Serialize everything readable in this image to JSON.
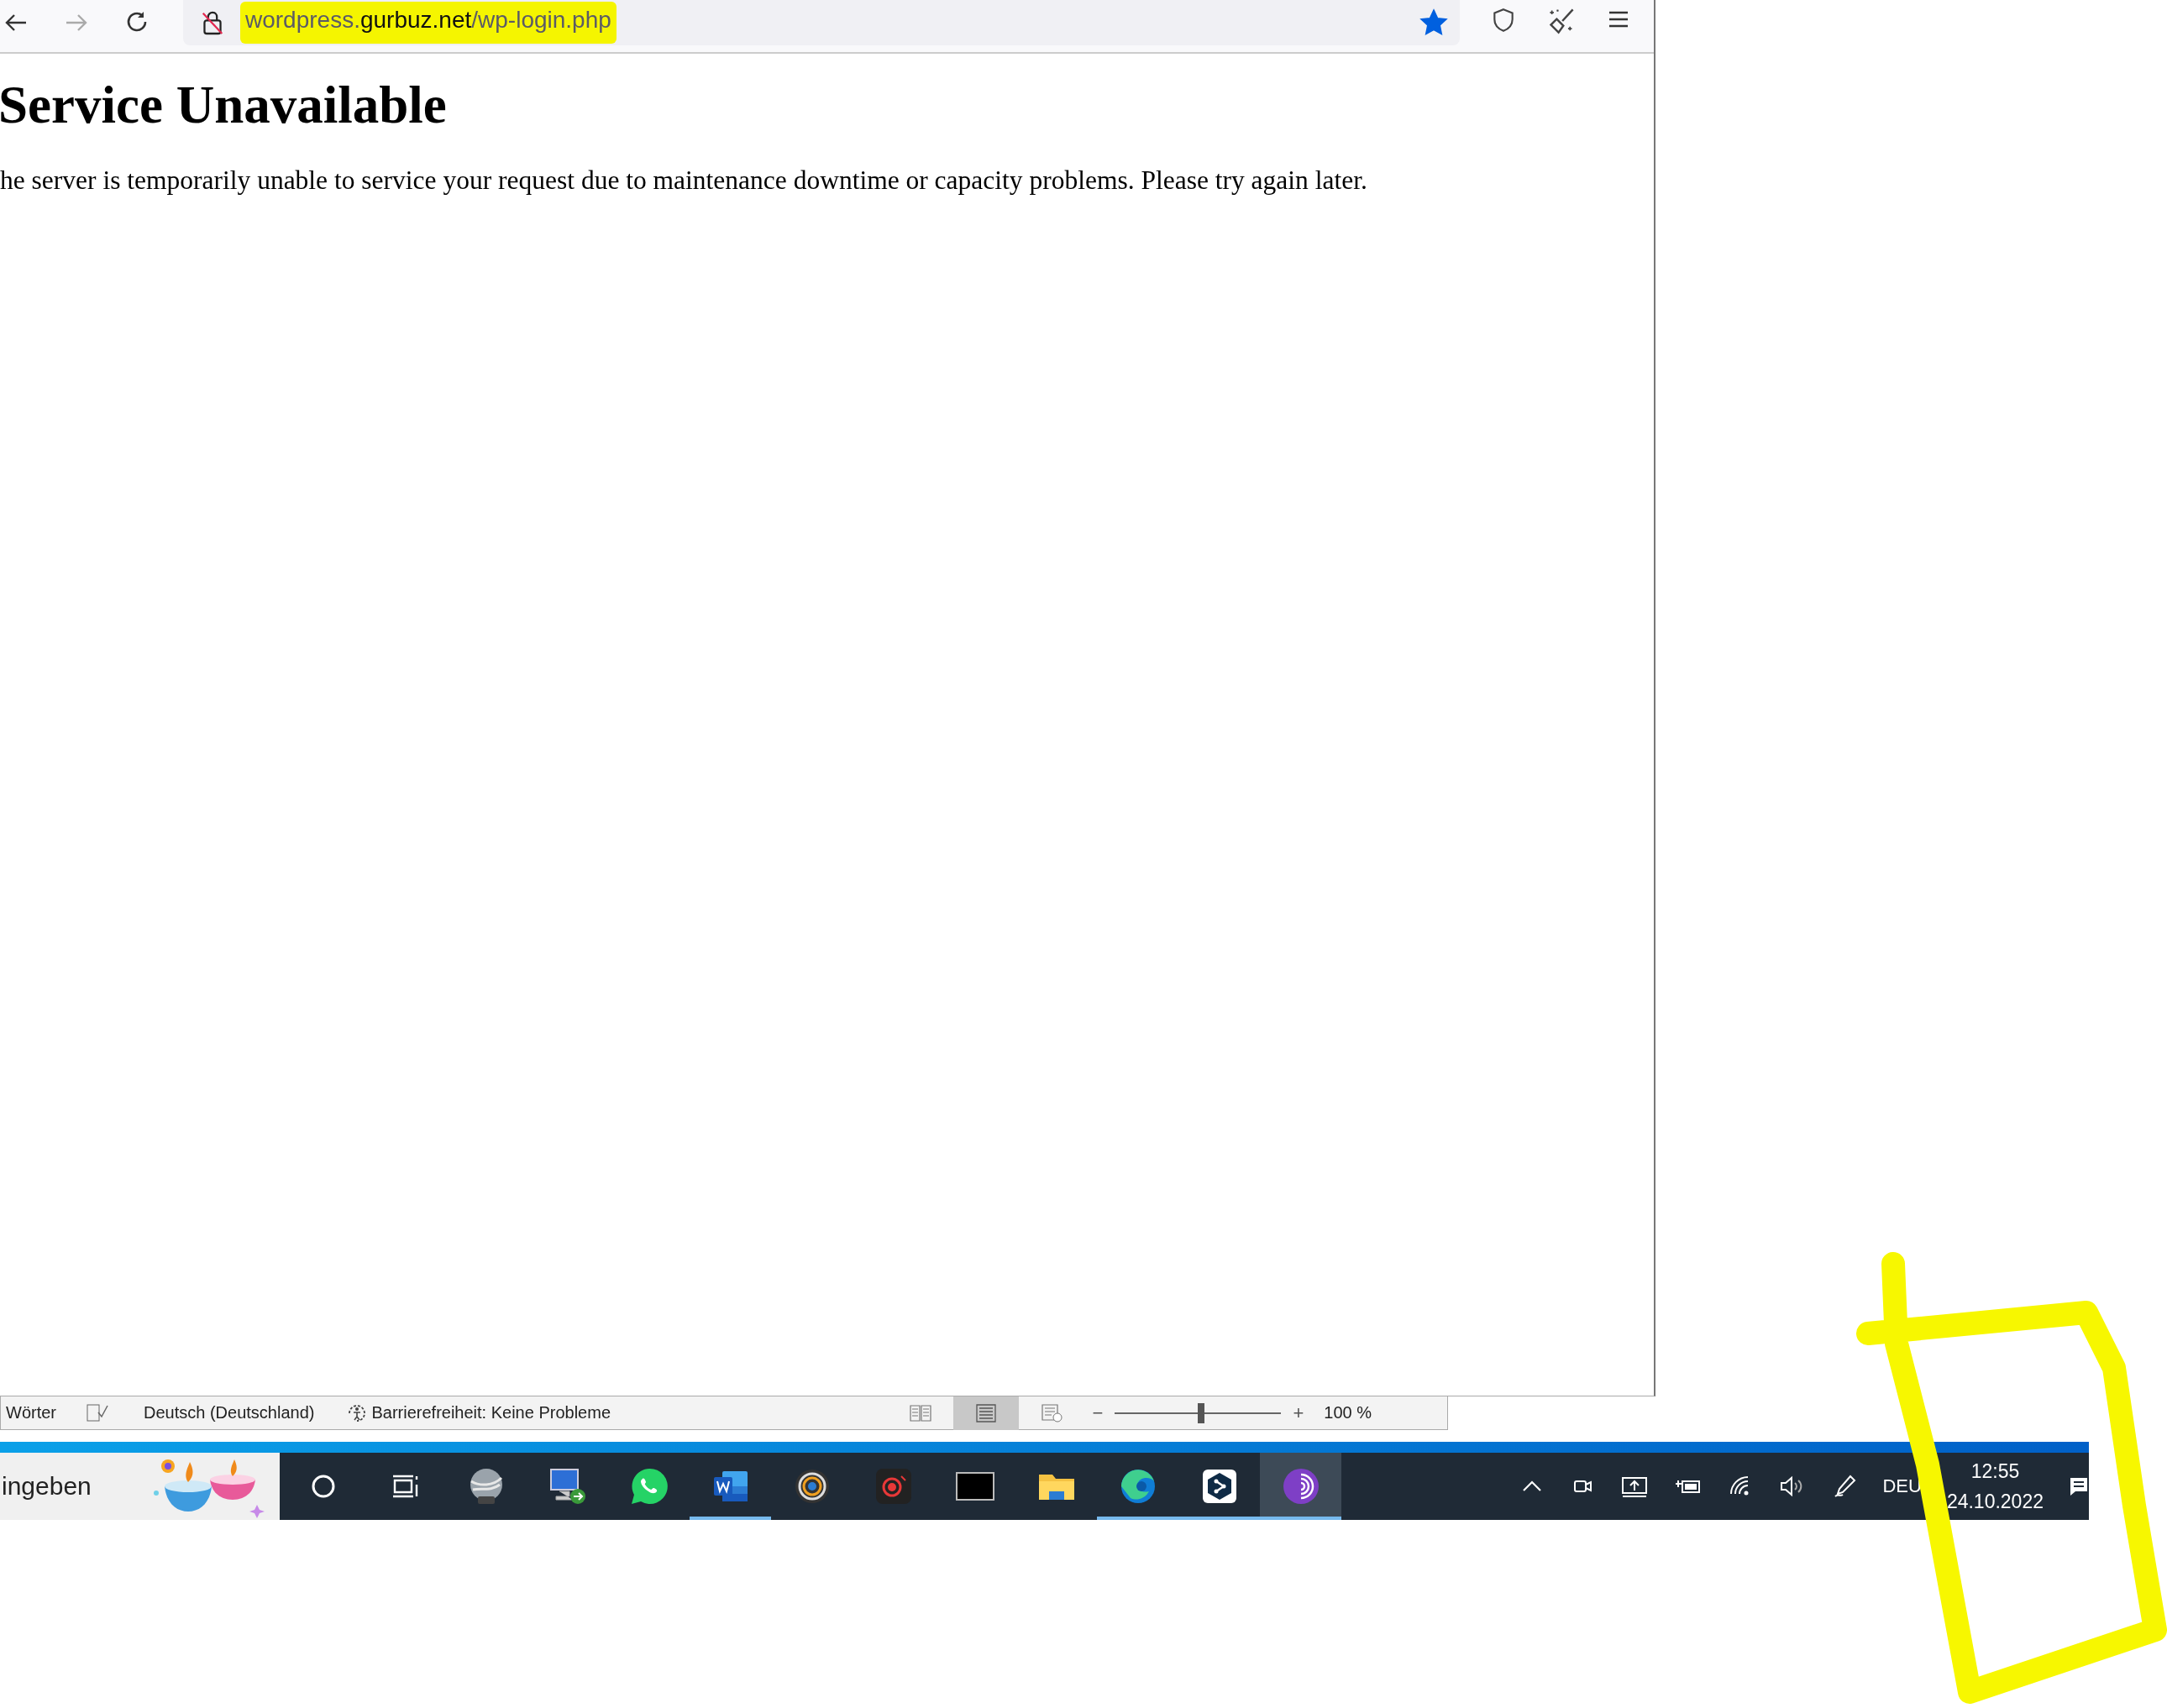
{
  "browser": {
    "url": {
      "prefix": "wordpress.",
      "domain": "gurbuz.net",
      "path": "/wp-login.php"
    },
    "bookmarked": true
  },
  "page": {
    "heading": "Service Unavailable",
    "message": "he server is temporarily unable to service your request due to maintenance downtime or capacity problems. Please try again later."
  },
  "word_status_bar": {
    "words": "Wörter",
    "language": "Deutsch (Deutschland)",
    "accessibility": "Barrierefreiheit: Keine Probleme",
    "views": [
      {
        "kind": "read",
        "selected": false
      },
      {
        "kind": "print",
        "selected": true
      },
      {
        "kind": "web",
        "selected": false
      }
    ],
    "zoom": {
      "out_sign": "−",
      "level": 0.5,
      "in_sign": "+",
      "reading": "100 %"
    }
  },
  "taskbar": {
    "search_text": "ingeben",
    "apps": [
      {
        "kind": "cortana",
        "running": false,
        "selected": false
      },
      {
        "kind": "taskview",
        "running": false,
        "selected": false
      },
      {
        "kind": "globe",
        "running": false,
        "selected": false
      },
      {
        "kind": "remote",
        "running": false,
        "selected": false
      },
      {
        "kind": "chat",
        "running": false,
        "selected": false
      },
      {
        "kind": "word",
        "running": true,
        "selected": false
      },
      {
        "kind": "ring",
        "running": false,
        "selected": false
      },
      {
        "kind": "record",
        "running": false,
        "selected": false
      },
      {
        "kind": "terminal",
        "running": false,
        "selected": false
      },
      {
        "kind": "folder",
        "running": false,
        "selected": false
      },
      {
        "kind": "edge",
        "running": true,
        "selected": false
      },
      {
        "kind": "share",
        "running": true,
        "selected": false
      },
      {
        "kind": "tor",
        "running": true,
        "selected": true
      }
    ],
    "language": "DEU",
    "time": "12:55",
    "date": "24.10.2022"
  }
}
